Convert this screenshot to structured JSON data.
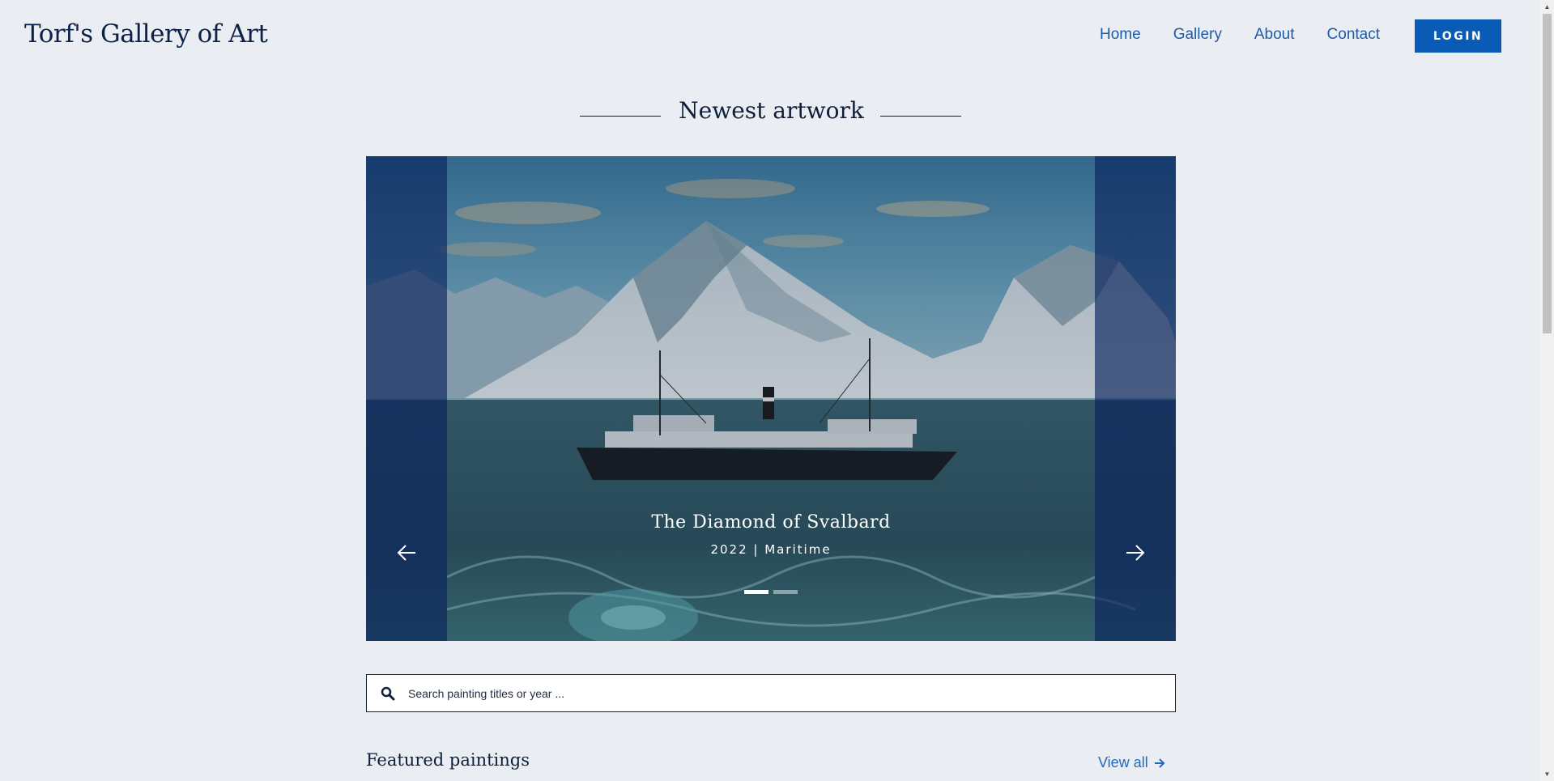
{
  "header": {
    "site_title": "Torf's Gallery of Art",
    "nav": [
      "Home",
      "Gallery",
      "About",
      "Contact"
    ],
    "login_label": "LOGIN"
  },
  "newest": {
    "heading": "Newest artwork",
    "slide": {
      "title": "The Diamond of Svalbard",
      "meta": "2022 | Maritime"
    },
    "slide_count": 2,
    "active_slide": 1
  },
  "search": {
    "placeholder": "Search painting titles or year ..."
  },
  "featured": {
    "heading": "Featured paintings",
    "view_all": "View all"
  },
  "icons": {
    "prev": "arrow-left-icon",
    "next": "arrow-right-icon",
    "search": "search-icon",
    "view_all": "arrow-right-icon"
  },
  "colors": {
    "page_bg": "#eaeef2",
    "brand_blue": "#0a5bb5",
    "nav_link": "#1f5aa6",
    "title_navy": "#0d2148"
  }
}
